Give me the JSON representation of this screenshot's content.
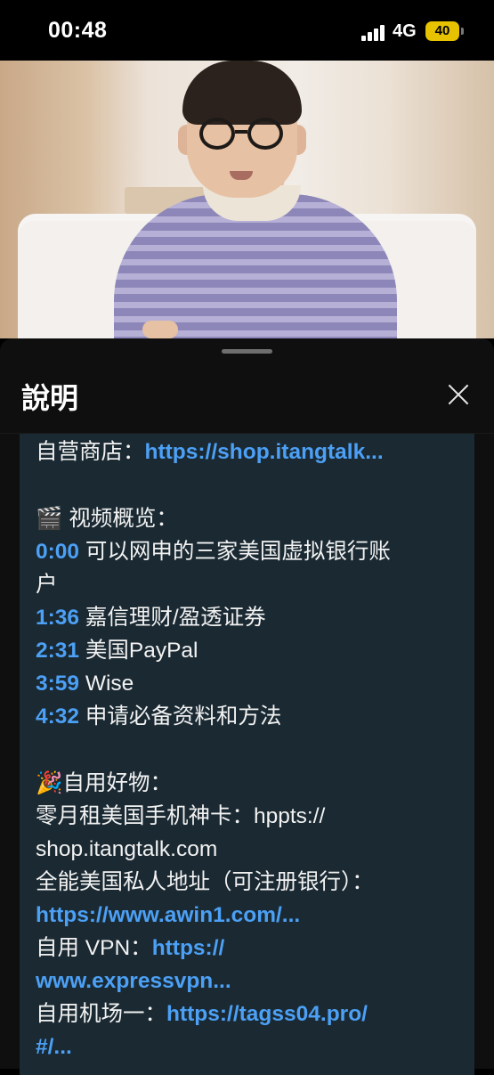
{
  "status_bar": {
    "time": "00:48",
    "network": "4G",
    "battery": "40"
  },
  "sheet": {
    "title": "說明"
  },
  "description": {
    "shop_label": "自营商店：",
    "shop_link": "https://shop.itangtalk...",
    "overview_icon": "🎬",
    "overview_label": " 视频概览：",
    "chapters": [
      {
        "time": "0:00",
        "title": "可以网申的三家美国虚拟银行账"
      },
      {
        "time": "",
        "title": "户"
      },
      {
        "time": "1:36",
        "title": "嘉信理财/盈透证券"
      },
      {
        "time": "2:31",
        "title": "美国PayPal"
      },
      {
        "time": "3:59",
        "title": "Wise"
      },
      {
        "time": "4:32",
        "title": "申请必备资料和方法"
      }
    ],
    "goods_icon": "🎉",
    "goods_label": "自用好物：",
    "sim_label": "零月租美国手机神卡：hppts://",
    "sim_label_cont": "shop.itangtalk.com",
    "address_label": "全能美国私人地址（可注册银行）：",
    "address_link": "https://www.awin1.com/...",
    "vpn_label": "自用 VPN：",
    "vpn_link_1": "https://",
    "vpn_link_2": "www.expressvpn...",
    "airport_label": "自用机场一：",
    "airport_link_1": "https://tagss04.pro/",
    "airport_link_2": "#/..."
  },
  "colors": {
    "link": "#4ca0f5",
    "card_bg": "#1a2932",
    "battery": "#e6c200"
  }
}
